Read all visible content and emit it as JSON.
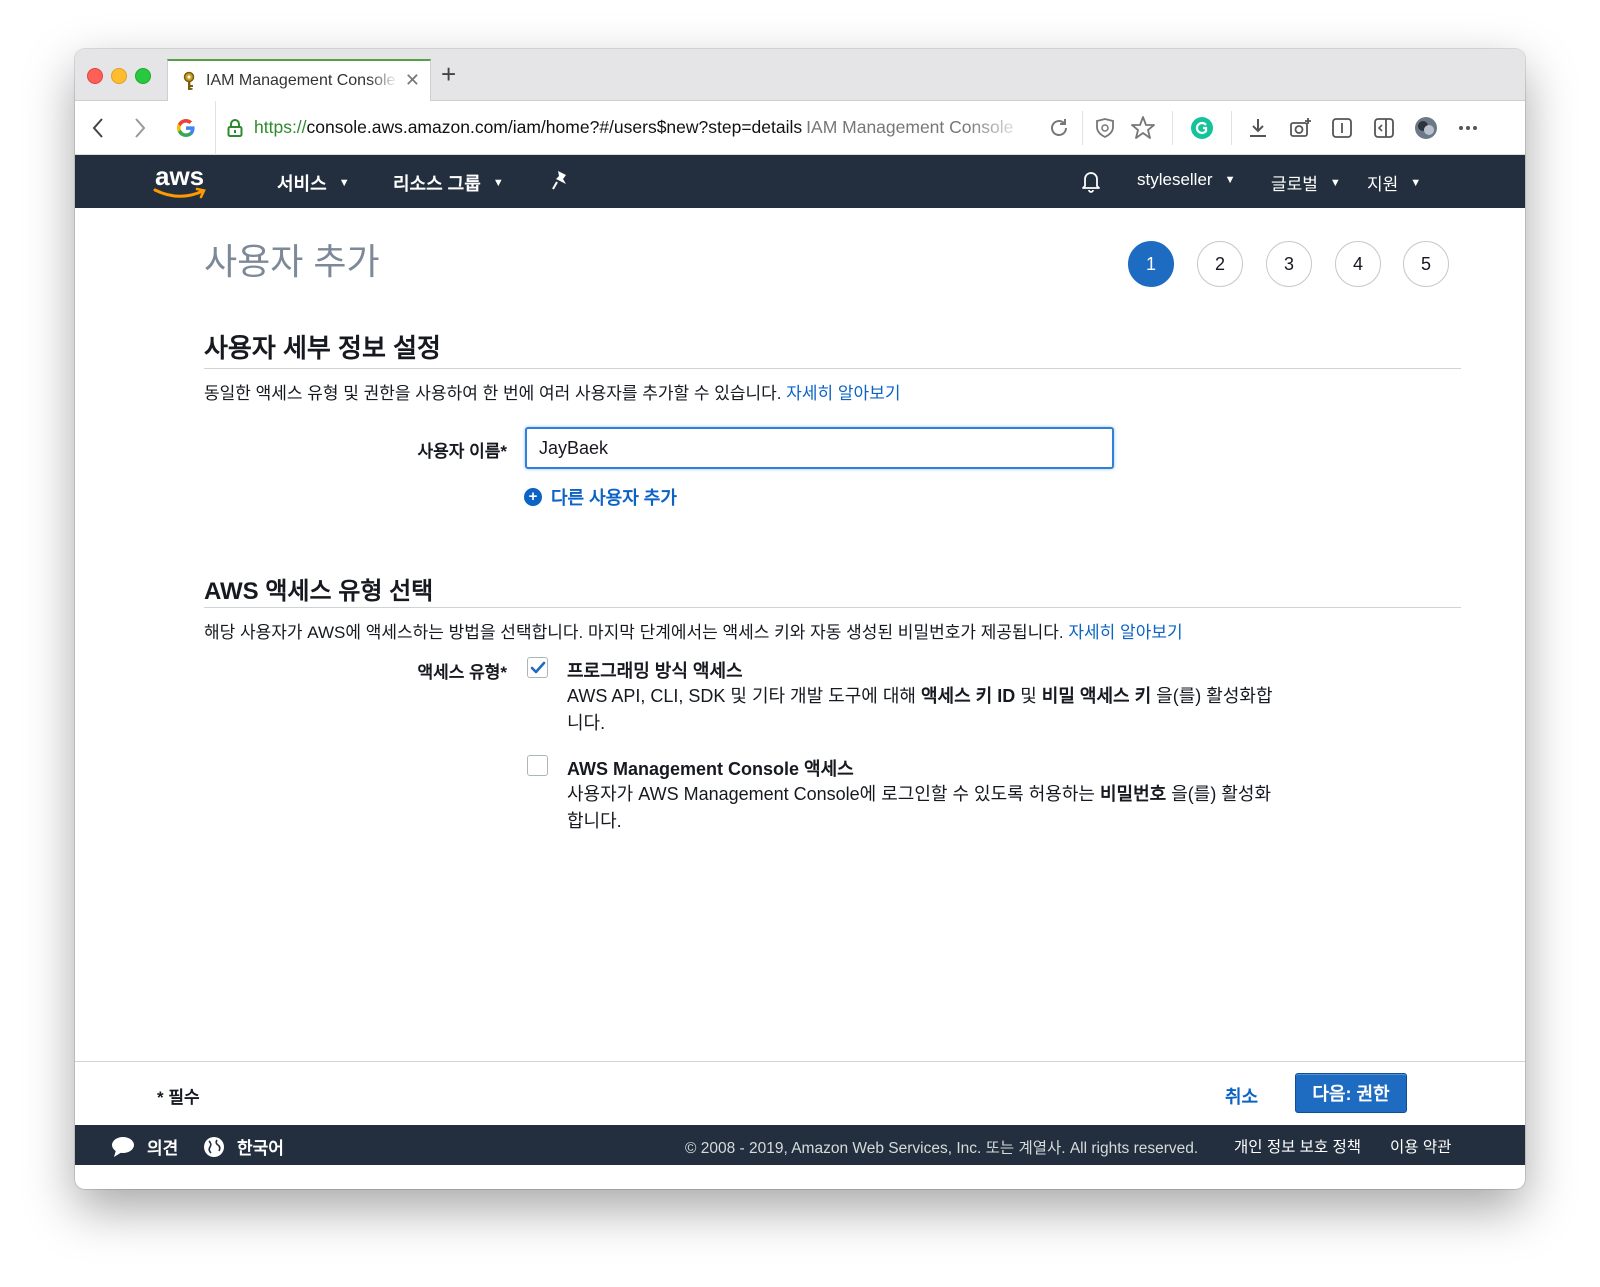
{
  "browser": {
    "tab_title": "IAM Management Console",
    "url_scheme": "https://",
    "url_rest": "console.aws.amazon.com/iam/home?#/users$new?step=details",
    "url_page_title": "IAM Management Console"
  },
  "aws_nav": {
    "logo": "aws",
    "services_label": "서비스",
    "resource_groups_label": "리소스 그룹",
    "account_label": "styleseller",
    "region_label": "글로벌",
    "support_label": "지원"
  },
  "page": {
    "title": "사용자 추가",
    "steps": [
      "1",
      "2",
      "3",
      "4",
      "5"
    ],
    "active_step": 1
  },
  "details_section": {
    "title": "사용자 세부 정보 설정",
    "description": "동일한 액세스 유형 및 권한을 사용하여 한 번에 여러 사용자를 추가할 수 있습니다.",
    "learn_more": "자세히 알아보기",
    "username_label": "사용자 이름*",
    "username_value": "JayBaek",
    "add_another_user": "다른 사용자 추가"
  },
  "access_section": {
    "title": "AWS 액세스 유형 선택",
    "description": "해당 사용자가 AWS에 액세스하는 방법을 선택합니다. 마지막 단계에서는 액세스 키와 자동 생성된 비밀번호가 제공됩니다.",
    "learn_more": "자세히 알아보기",
    "access_type_label": "액세스 유형*",
    "options": [
      {
        "title": "프로그래밍 방식 액세스",
        "checked": true,
        "desc_pre": "AWS API, CLI, SDK 및 기타 개발 도구에 대해 ",
        "desc_bold1": "액세스 키 ID",
        "desc_mid": " 및 ",
        "desc_bold2": "비밀 액세스 키",
        "desc_post": " 을(를) 활성화합니다."
      },
      {
        "title": "AWS Management Console 액세스",
        "checked": false,
        "desc_pre": "사용자가 AWS Management Console에 로그인할 수 있도록 허용하는 ",
        "desc_bold1": "비밀번호",
        "desc_post": " 을(를) 활성화합니다."
      }
    ]
  },
  "footer": {
    "required_note": "* 필수",
    "cancel_label": "취소",
    "next_label": "다음: 권한",
    "feedback_label": "의견",
    "language_label": "한국어",
    "copyright": "© 2008 - 2019, Amazon Web Services, Inc. 또는 계열사. All rights reserved.",
    "privacy_label": "개인 정보 보호 정책",
    "terms_label": "이용 약관"
  },
  "colors": {
    "nav_bg": "#232f3e",
    "primary": "#1e6bc2",
    "link": "#0c63c6",
    "tab_accent": "#53a247"
  }
}
